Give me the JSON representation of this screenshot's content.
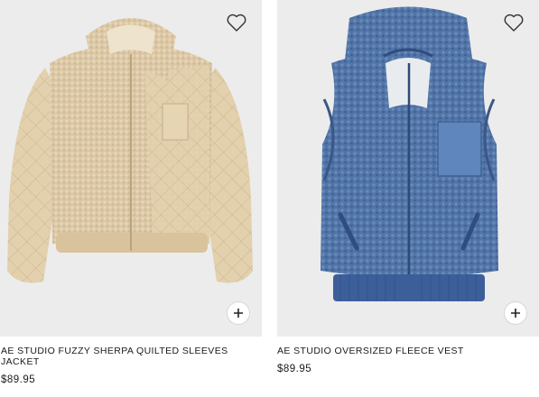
{
  "products": [
    {
      "name": "AE STUDIO FUZZY SHERPA QUILTED SLEEVES JACKET",
      "price": "$89.95",
      "image_color": "#dcc8a6",
      "favorite_icon": "heart-outline-icon",
      "add_icon": "plus-icon"
    },
    {
      "name": "AE STUDIO OVERSIZED FLEECE VEST",
      "price": "$89.95",
      "image_color": "#5275a8",
      "favorite_icon": "heart-outline-icon",
      "add_icon": "plus-icon"
    }
  ]
}
